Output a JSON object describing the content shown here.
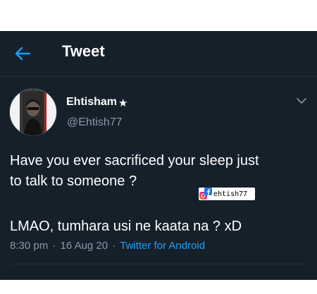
{
  "header": {
    "title": "Tweet"
  },
  "author": {
    "name": "Ehtisham",
    "badge": "★",
    "handle": "@Ehtish77"
  },
  "tweet": {
    "line1": "Have you ever sacrificed your sleep just",
    "line2": "to talk to someone ?",
    "line3": "LMAO, tumhara usi ne kaata na ? xD"
  },
  "meta": {
    "time": "8:30 pm",
    "separator": "·",
    "date": "16 Aug 20",
    "app": "Twitter for Android"
  },
  "watermark": {
    "text": "ehtish77"
  },
  "colors": {
    "background": "#15202b",
    "accent": "#1da1f2",
    "secondary_text": "#8899a6",
    "divider": "#22303c"
  },
  "icons": {
    "back": "back-arrow-icon",
    "menu": "chevron-down-icon",
    "watermark": "facebook-instagram-logo"
  }
}
